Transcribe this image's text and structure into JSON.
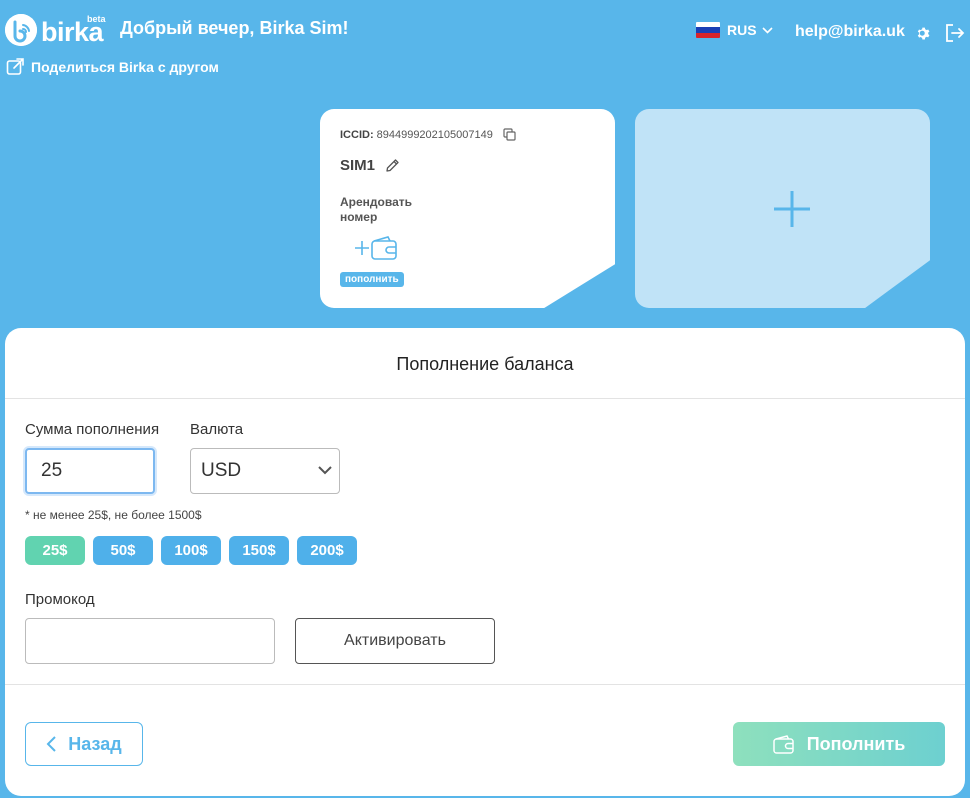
{
  "header": {
    "logo_text": "birka",
    "logo_badge": "beta",
    "greeting": "Добрый вечер, Birka Sim!",
    "share_label": "Поделиться Birka с другом",
    "language": "RUS",
    "email": "help@birka.uk"
  },
  "sim_card": {
    "iccid_label": "ICCID:",
    "iccid_value": "8944999202105007149",
    "name": "SIM1",
    "rent_label": "Арендовать номер",
    "topup_badge": "пополнить"
  },
  "panel": {
    "title": "Пополнение баланса",
    "amount_label": "Сумма пополнения",
    "amount_value": "25",
    "currency_label": "Валюта",
    "currency_value": "USD",
    "hint": "* не менее 25$, не более 1500$",
    "chips": [
      "25$",
      "50$",
      "100$",
      "150$",
      "200$"
    ],
    "promo_label": "Промокод",
    "promo_value": "",
    "activate_label": "Активировать",
    "back_label": "Назад",
    "submit_label": "Пополнить"
  },
  "colors": {
    "brand_blue": "#58b6ea",
    "chip_active": "#61d3b0",
    "submit_gradient_start": "#8ee0bd",
    "submit_gradient_end": "#6dd0d0"
  },
  "icons": [
    "birka-logo-icon",
    "share-icon",
    "russia-flag-icon",
    "chevron-down-icon",
    "gear-icon",
    "logout-icon",
    "copy-icon",
    "pencil-icon",
    "plus-icon",
    "wallet-icon",
    "chevron-left-icon"
  ]
}
